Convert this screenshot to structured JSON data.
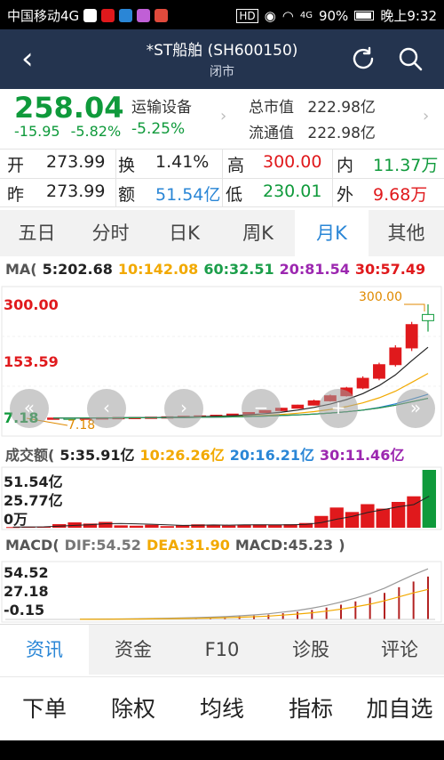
{
  "status_bar": {
    "carrier": "中国移动4G",
    "battery": "90%",
    "time": "晚上9:32",
    "hd": "HD",
    "signal": "4G"
  },
  "header": {
    "title": "*ST船舶 (SH600150)",
    "subtitle": "闭市"
  },
  "quote": {
    "price": "258.04",
    "change": "-15.95",
    "change_pct": "-5.82%",
    "industry": "运输设备",
    "industry_change": "-5.25%",
    "market_cap_label": "总市值",
    "market_cap": "222.98亿",
    "float_cap_label": "流通值",
    "float_cap": "222.98亿"
  },
  "stats": {
    "open_label": "开",
    "open": "273.99",
    "turnover_label": "换",
    "turnover": "1.41%",
    "high_label": "高",
    "high": "300.00",
    "inner_label": "内",
    "inner": "11.37万",
    "prev_label": "昨",
    "prev": "273.99",
    "amount_label": "额",
    "amount": "51.54亿",
    "low_label": "低",
    "low": "230.01",
    "outer_label": "外",
    "outer": "9.68万"
  },
  "period_tabs": [
    "五日",
    "分时",
    "日K",
    "周K",
    "月K",
    "其他"
  ],
  "active_period": 4,
  "ma": {
    "label": "MA(",
    "ma5": "5:202.68",
    "ma10": "10:142.08",
    "ma60": "60:32.51",
    "ma20": "20:81.54",
    "ma30": "30:57.49"
  },
  "price_axis": {
    "top": "300.00",
    "mid": "153.59",
    "bottom": "7.18",
    "high_marker": "300.00",
    "low_marker": "7.18"
  },
  "volume": {
    "label": "成交额(",
    "ma5": "5:35.91亿",
    "ma10": "10:26.26亿",
    "ma20": "20:16.21亿",
    "ma30": "30:11.46亿",
    "axis_top": "51.54亿",
    "axis_mid": "25.77亿",
    "axis_bottom": "0万"
  },
  "macd": {
    "label": "MACD(",
    "dif": "DIF:54.52",
    "dea": "DEA:31.90",
    "macd": "MACD:45.23",
    "close": ")",
    "axis_top": "54.52",
    "axis_mid": "27.18",
    "axis_bottom": "-0.15"
  },
  "info_tabs": [
    "资讯",
    "资金",
    "F10",
    "诊股",
    "评论"
  ],
  "active_info": 0,
  "actions": [
    "下单",
    "除权",
    "均线",
    "指标",
    "加自选"
  ],
  "colors": {
    "up": "#e0191c",
    "down": "#0f9a3b",
    "ma5": "#222222",
    "ma10": "#f2a900",
    "ma20": "#2a86d6",
    "ma30": "#9c27b0",
    "ma60": "#1b9e4a",
    "accent": "#2a86d6",
    "header": "#24344f"
  },
  "chart_data": {
    "type": "candlestick",
    "candles": [
      [
        7.5,
        8.2,
        7.2,
        7.8
      ],
      [
        7.8,
        8.3,
        7.4,
        7.6
      ],
      [
        7.6,
        8.0,
        7.18,
        7.9
      ],
      [
        7.9,
        8.8,
        7.7,
        8.6
      ],
      [
        8.6,
        9.4,
        8.4,
        9.2
      ],
      [
        9.2,
        9.9,
        8.9,
        9.6
      ],
      [
        9.6,
        10.5,
        9.3,
        10.2
      ],
      [
        10.2,
        11.3,
        10.0,
        11.0
      ],
      [
        11.0,
        12.5,
        10.8,
        12.2
      ],
      [
        12.2,
        13.6,
        11.9,
        13.3
      ],
      [
        13.3,
        15.5,
        13.0,
        15.0
      ],
      [
        15.0,
        18.5,
        14.6,
        18.0
      ],
      [
        18.0,
        23.0,
        17.5,
        22.0
      ],
      [
        22.0,
        28.0,
        21.0,
        27.0
      ],
      [
        27.0,
        34.0,
        26.0,
        33.0
      ],
      [
        33.0,
        42.0,
        32.0,
        41.0
      ],
      [
        41.0,
        55.0,
        40.0,
        52.0
      ],
      [
        52.0,
        68.0,
        50.0,
        65.0
      ],
      [
        65.0,
        88.0,
        63.0,
        85.0
      ],
      [
        85.0,
        115.0,
        82.0,
        110.0
      ],
      [
        110.0,
        150.0,
        105.0,
        145.0
      ],
      [
        145.0,
        195.0,
        140.0,
        188.0
      ],
      [
        188.0,
        255.0,
        180.0,
        248.0
      ],
      [
        273.99,
        300.0,
        230.01,
        258.04
      ]
    ],
    "amount": [
      0.6,
      0.8,
      0.9,
      3.2,
      4.8,
      3.7,
      5.2,
      2.1,
      1.8,
      2.6,
      1.4,
      2.3,
      3.0,
      2.8,
      1.9,
      2.6,
      2.9,
      2.4,
      3.1,
      4.2,
      10.5,
      18.0,
      14.0,
      21.0,
      17.0,
      23.0,
      28.0,
      51.54
    ],
    "macd_hist": [
      0.1,
      0.2,
      0.3,
      0.4,
      0.6,
      0.8,
      1.0,
      1.3,
      1.6,
      2.0,
      2.5,
      3.2,
      4.0,
      5.0,
      6.5,
      8.0,
      10.0,
      12.5,
      15.5,
      19.0,
      23.0,
      28.0,
      34.0,
      40.0,
      45.23
    ]
  }
}
